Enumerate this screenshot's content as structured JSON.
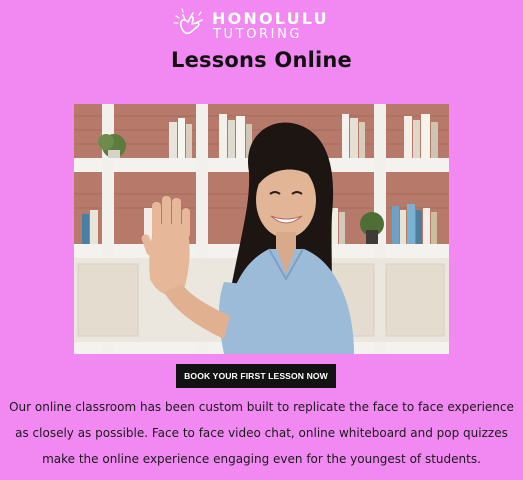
{
  "brand": {
    "line1": "HONOLULU",
    "line2": "TUTORING",
    "icon": "shaka-hand-icon"
  },
  "page_title": "Lessons Online",
  "hero_image": {
    "subject": "woman waving in front of bookshelves"
  },
  "cta_button": {
    "label": "BOOK YOUR FIRST LESSON NOW"
  },
  "description": {
    "lines": [
      "Our online classroom has been custom built to replicate the face to face experience",
      "as closely as possible. Face to face video chat, online whiteboard and pop quizzes",
      "make the online experience engaging even for the youngest of students."
    ]
  },
  "colors": {
    "background": "#f289f3",
    "button_bg": "#121212",
    "button_text": "#ffffff",
    "logo": "#ffffff"
  }
}
